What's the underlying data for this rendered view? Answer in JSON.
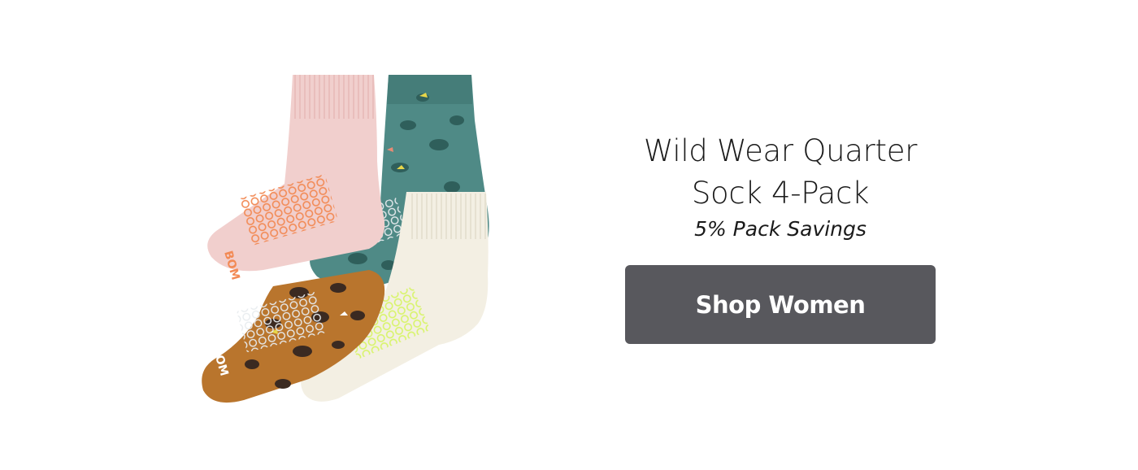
{
  "product": {
    "title_line1": "Wild Wear Quarter",
    "title_line2": "Sock 4-Pack",
    "subtitle": "5% Pack Savings",
    "image_alt": "Four quarter socks: pink, teal leopard, tan leopard and cream"
  },
  "cta": {
    "label": "Shop Women"
  },
  "sock_brand_mark": "BOM",
  "colors": {
    "button_bg": "#58585d",
    "button_text": "#ffffff",
    "text": "#1a1a1a",
    "background": "#ffffff",
    "sock_pink": "#f1cfcd",
    "sock_teal": "#4f8a86",
    "sock_tan": "#b9752d",
    "sock_cream": "#f3efe3"
  }
}
